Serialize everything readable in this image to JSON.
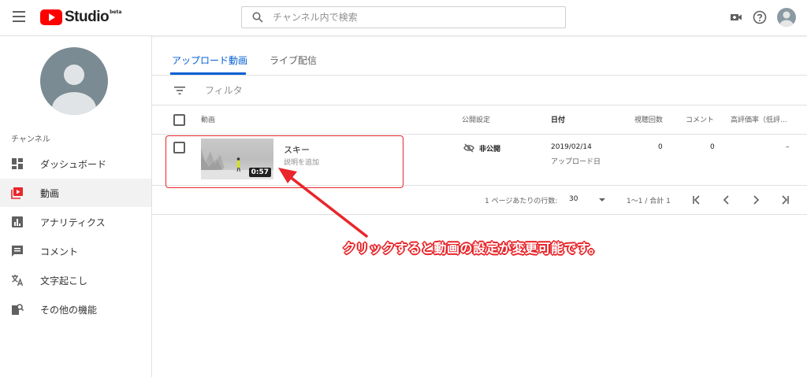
{
  "header": {
    "logo_text": "Studio",
    "logo_badge": "beta",
    "search_placeholder": "チャンネル内で検索"
  },
  "sidebar": {
    "heading": "チャンネル",
    "items": [
      {
        "label": "ダッシュボード",
        "icon": "dashboard-icon"
      },
      {
        "label": "動画",
        "icon": "video-icon",
        "active": true
      },
      {
        "label": "アナリティクス",
        "icon": "analytics-icon"
      },
      {
        "label": "コメント",
        "icon": "comment-icon"
      },
      {
        "label": "文字起こし",
        "icon": "translate-icon"
      },
      {
        "label": "その他の機能",
        "icon": "other-features-icon"
      }
    ]
  },
  "main": {
    "tabs": [
      {
        "label": "アップロード動画",
        "active": true
      },
      {
        "label": "ライブ配信"
      }
    ],
    "filter_placeholder": "フィルタ",
    "table": {
      "headers": {
        "video": "動画",
        "visibility": "公開設定",
        "date": "日付",
        "views": "視聴回数",
        "comments": "コメント",
        "rating": "高評価率（低評..."
      },
      "rows": [
        {
          "duration": "0:57",
          "title": "スキー",
          "description": "説明を追加",
          "visibility": "非公開",
          "date": "2019/02/14",
          "date_sub": "アップロード日",
          "views": "0",
          "comments": "0",
          "rating": "–"
        }
      ]
    },
    "pagination": {
      "rows_per_page_label": "1 ページあたりの行数:",
      "rows_per_page": "30",
      "range": "1～1 / 合計 1"
    }
  },
  "annotation": {
    "text": "クリックすると動画の設定が変更可能です。",
    "color": "#e8262b"
  },
  "colors": {
    "accent": "#065fd4",
    "brand": "#ff0000",
    "highlight": "#e8262b"
  }
}
